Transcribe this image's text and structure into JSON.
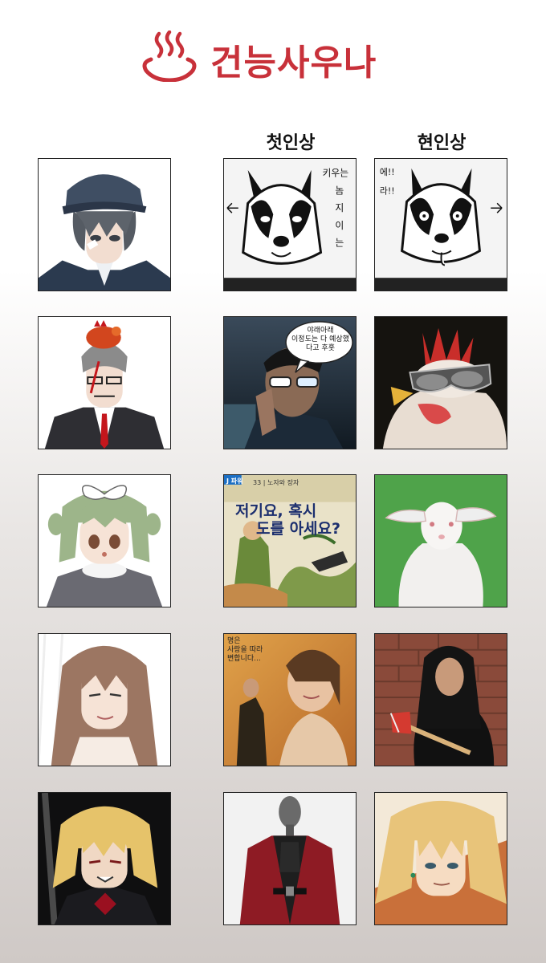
{
  "header": {
    "title": "건능사우나",
    "icon": "hot-springs-icon",
    "accent_color": "#c8313a"
  },
  "columns": {
    "first_impression": "첫인상",
    "current_impression": "현인상"
  },
  "rows": [
    {
      "character": "character-police-cap-boy",
      "first": "husky-manga-panel",
      "current": "goofy-husky-drawing",
      "first_texts": {
        "vertical_caption": "키우는 놈 지 이 는"
      },
      "current_texts": {
        "exclaim": "에!! 라!!"
      }
    },
    {
      "character": "character-suit-man-with-chicken",
      "first": "man-glowing-glasses-photo",
      "current": "rooster-with-sunglasses-photo",
      "first_texts": {
        "bubble_line1": "야래아래",
        "bubble_line2": "이정도는 다 예상했",
        "bubble_line3": "다고 후훗"
      }
    },
    {
      "character": "character-green-hair-girl",
      "first": "korean-picture-book-cover",
      "current": "white-rabbit-photo",
      "first_texts": {
        "series": "33 | 노자와 장자",
        "title_line1": "저기요, 혹시",
        "title_line2": "도를 아세요?",
        "publisher": "J 파워"
      }
    },
    {
      "character": "character-long-hair-woman",
      "first": "period-drama-poster",
      "current": "woman-with-axe-photo",
      "first_texts": {
        "tagline_line1": "명은",
        "tagline_line2": "사랑을 따라",
        "tagline_line3": "변합니다..."
      }
    },
    {
      "character": "character-blond-vampire-boy",
      "first": "red-velvet-coat-mannequin",
      "current": "blond-anime-wizard"
    }
  ]
}
